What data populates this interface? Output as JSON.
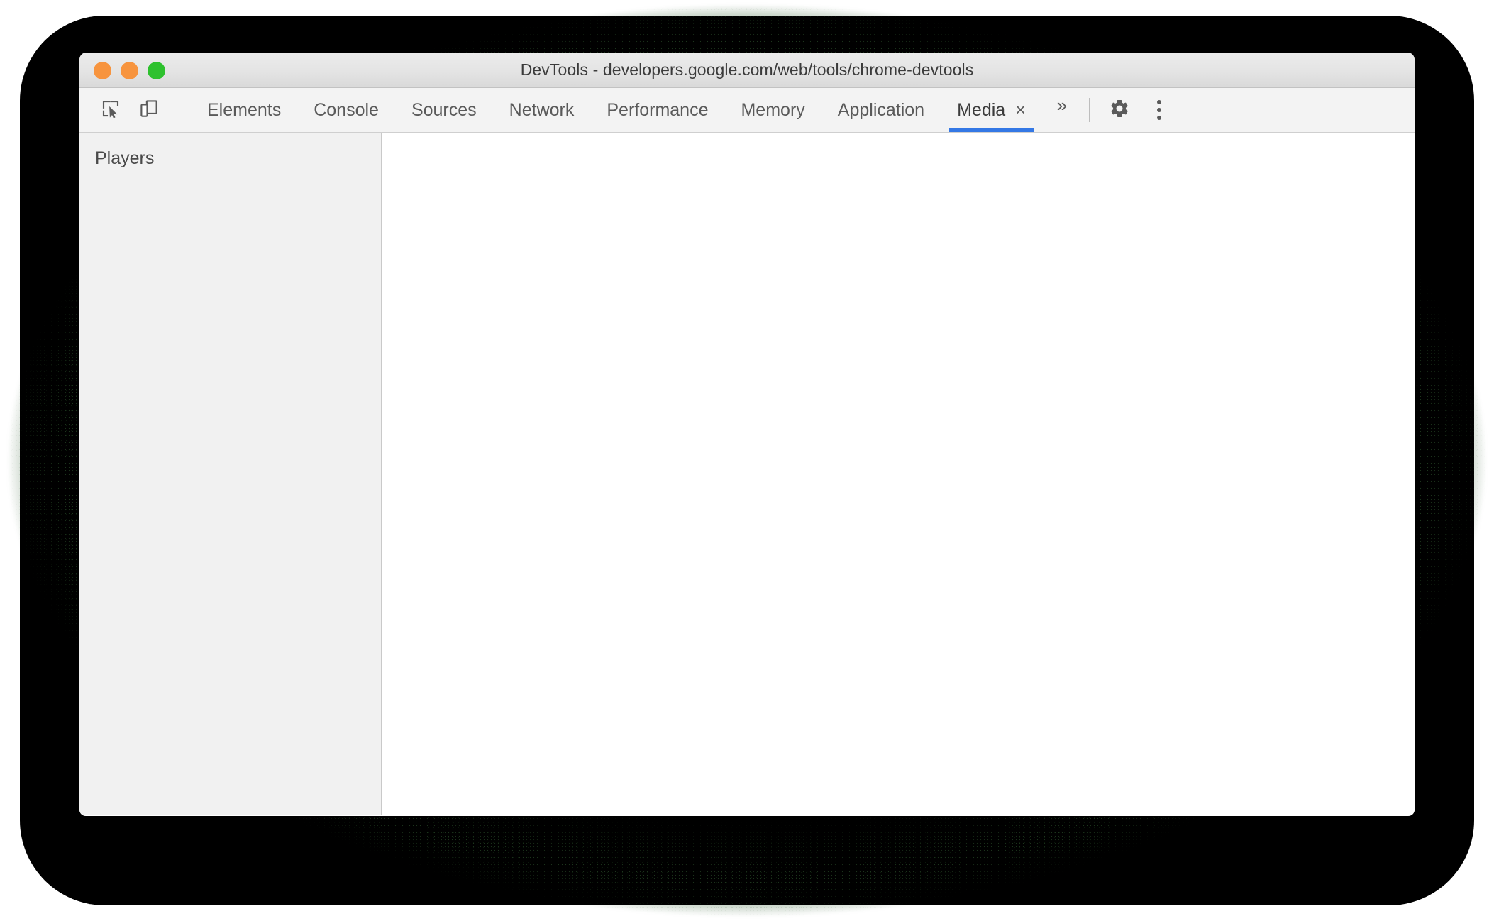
{
  "window": {
    "title": "DevTools - developers.google.com/web/tools/chrome-devtools",
    "traffic_lights": [
      {
        "name": "close",
        "color": "#f7943e"
      },
      {
        "name": "minimize",
        "color": "#f7943e"
      },
      {
        "name": "maximize",
        "color": "#2ec12e"
      }
    ]
  },
  "toolbar": {
    "icons": [
      {
        "name": "inspect-element-icon",
        "label": "Inspect element"
      },
      {
        "name": "device-toolbar-icon",
        "label": "Toggle device toolbar"
      }
    ],
    "tabs": [
      {
        "label": "Elements",
        "active": false
      },
      {
        "label": "Console",
        "active": false
      },
      {
        "label": "Sources",
        "active": false
      },
      {
        "label": "Network",
        "active": false
      },
      {
        "label": "Performance",
        "active": false
      },
      {
        "label": "Memory",
        "active": false
      },
      {
        "label": "Application",
        "active": false
      },
      {
        "label": "Media",
        "active": true,
        "closable": true,
        "close_glyph": "×"
      }
    ],
    "more_tabs_glyph": "»",
    "settings_icon": "gear-icon",
    "menu_icon": "more-vertical-icon",
    "accent_color": "#3478e5"
  },
  "main": {
    "sidebar": {
      "title": "Players",
      "items": []
    },
    "content": {
      "empty": true,
      "text": ""
    }
  },
  "colors": {
    "backdrop": "#000000",
    "titlebar": "#e7e7e7",
    "toolbar": "#f3f3f3",
    "sidebar": "#f1f1f1",
    "content": "#ffffff",
    "accent": "#3478e5"
  }
}
